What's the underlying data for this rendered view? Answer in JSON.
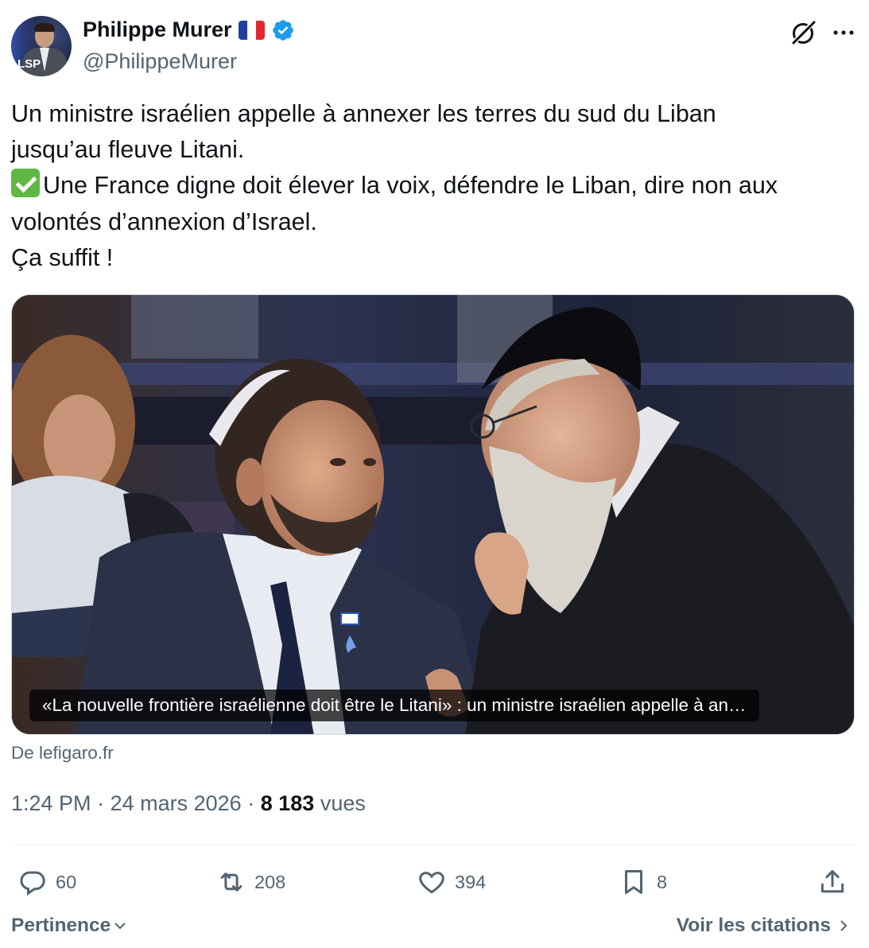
{
  "author": {
    "display_name": "Philippe Murer",
    "handle": "@PhilippeMurer",
    "flag_icon": "flag-france-icon",
    "verified_icon": "verified-badge-icon",
    "avatar_logo": "LSP"
  },
  "header_icons": {
    "grok": "grok-icon",
    "more": "more-icon"
  },
  "tweet": {
    "lines": [
      "Un ministre israélien appelle à annexer les terres du sud du Liban",
      "jusqu’au fleuve Litani.",
      "Une France digne doit élever la voix, défendre le Liban, dire non aux",
      "volontés d’annexion d’Israel.",
      "Ça suffit !"
    ]
  },
  "card": {
    "caption": "«La nouvelle frontière israélienne doit être le Litani» : un ministre israélien appelle à an…",
    "source": "De lefigaro.fr"
  },
  "meta": {
    "time": "1:24 PM",
    "separator": "·",
    "date": "24 mars 2026",
    "views_count": "8 183",
    "views_label": "vues"
  },
  "actions": {
    "replies": "60",
    "reposts": "208",
    "likes": "394",
    "bookmarks": "8"
  },
  "footer": {
    "sort_label": "Pertinence",
    "quotes_label": "Voir les citations"
  },
  "colors": {
    "text_primary": "#0f1419",
    "text_secondary": "#536471",
    "verified_blue": "#1d9bf0",
    "check_green": "#5eb842",
    "divider": "#eff3f4"
  }
}
